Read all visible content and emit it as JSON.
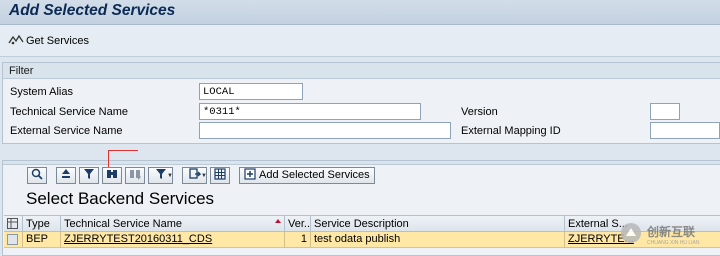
{
  "window": {
    "title": "Add Selected Services"
  },
  "appbar": {
    "get_services_label": "Get Services"
  },
  "filter": {
    "header": "Filter",
    "system_alias": {
      "label": "System Alias",
      "value": "LOCAL"
    },
    "technical_service_name": {
      "label": "Technical Service Name",
      "value": "*0311*"
    },
    "external_service_name": {
      "label": "External Service Name",
      "value": ""
    },
    "version": {
      "label": "Version",
      "value": ""
    },
    "external_mapping_id": {
      "label": "External Mapping ID",
      "value": ""
    }
  },
  "toolbar": {
    "icons": [
      "details-icon",
      "sort-ascending-icon",
      "filter-icon",
      "find-icon",
      "find-next-icon",
      "set-filter-icon",
      "export-icon",
      "layout-icon"
    ],
    "add_selected_label": "Add Selected Services"
  },
  "section": {
    "title": "Select Backend Services"
  },
  "table": {
    "columns": [
      "Type",
      "Technical Service Name",
      "Ver...",
      "Service Description",
      "External S..."
    ],
    "rows": [
      {
        "type": "BEP",
        "technical_service_name": "ZJERRYTEST20160311_CDS",
        "version": "1",
        "description": "test odata publish",
        "external": "ZJERRYTE..."
      }
    ]
  },
  "watermark": {
    "text": "创新互联",
    "sub": "CHUANG XIN HU LIAN"
  },
  "colors": {
    "title_text": "#0a2a55",
    "selected_row": "#ffe8a6",
    "sort_marker": "#c8102e",
    "annotation_line": "#dd3333"
  }
}
